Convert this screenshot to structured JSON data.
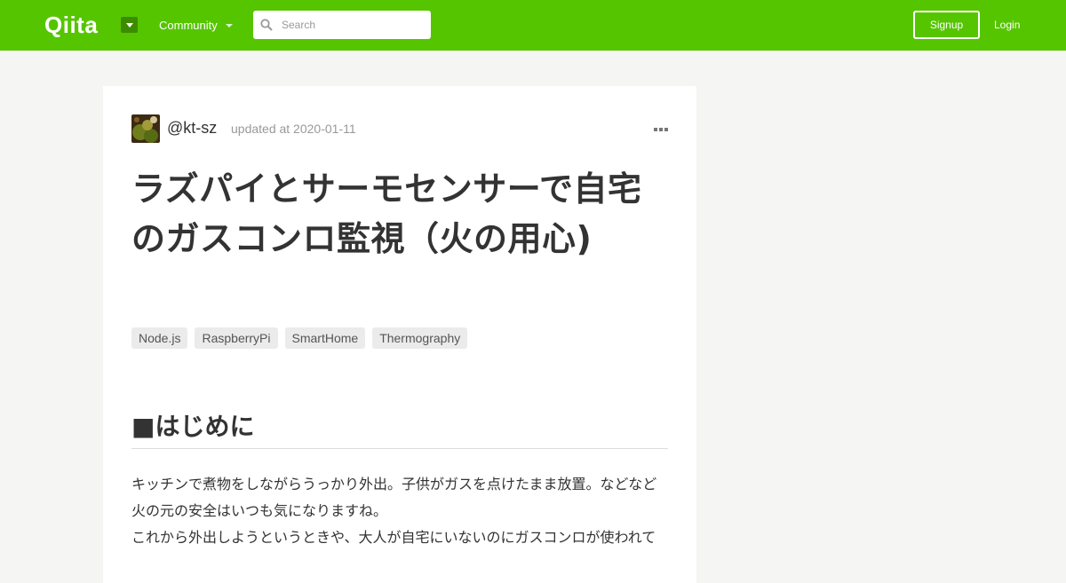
{
  "header": {
    "logo": "Qiita",
    "community_label": "Community",
    "search_placeholder": "Search",
    "signup_label": "Signup",
    "login_label": "Login",
    "brand_color": "#55c500"
  },
  "article": {
    "username": "@kt-sz",
    "updated": "updated at 2020-01-11",
    "title": "ラズパイとサーモセンサーで自宅のガスコンロ監視（火の用心)",
    "tags": [
      "Node.js",
      "RaspberryPi",
      "SmartHome",
      "Thermography"
    ],
    "section_heading": "■はじめに",
    "paragraph_lines": [
      "キッチンで煮物をしながらうっかり外出。子供がガスを点けたまま放置。などなど",
      "火の元の安全はいつも気になりますね。",
      "これから外出しようというときや、大人が自宅にいないのにガスコンロが使われて"
    ]
  }
}
